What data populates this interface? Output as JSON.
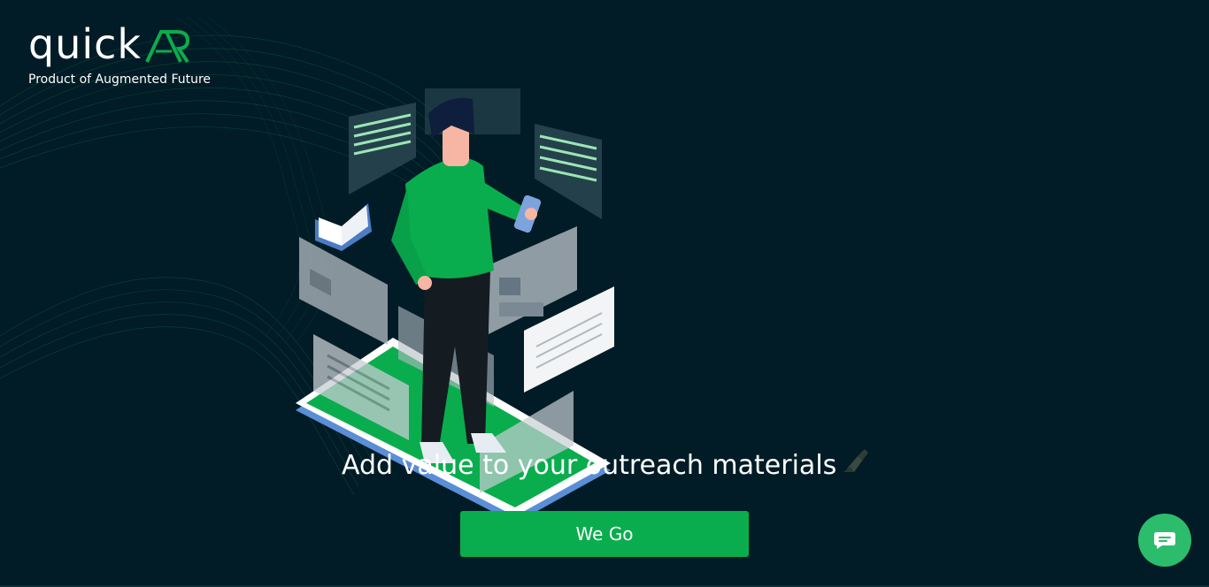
{
  "brand": {
    "logo_word": "quick",
    "logo_mark": "AR",
    "tagline": "Product of Augmented Future"
  },
  "hero": {
    "headline": "Add value to your outreach materials",
    "headline_icon": "writing-hand-icon",
    "cta_label": "We Go"
  },
  "chat": {
    "icon": "chat-bubble-icon"
  },
  "colors": {
    "background": "#011c26",
    "accent": "#0aad4d",
    "chat": "#2bbd6b",
    "wave": "#1a8a55"
  }
}
